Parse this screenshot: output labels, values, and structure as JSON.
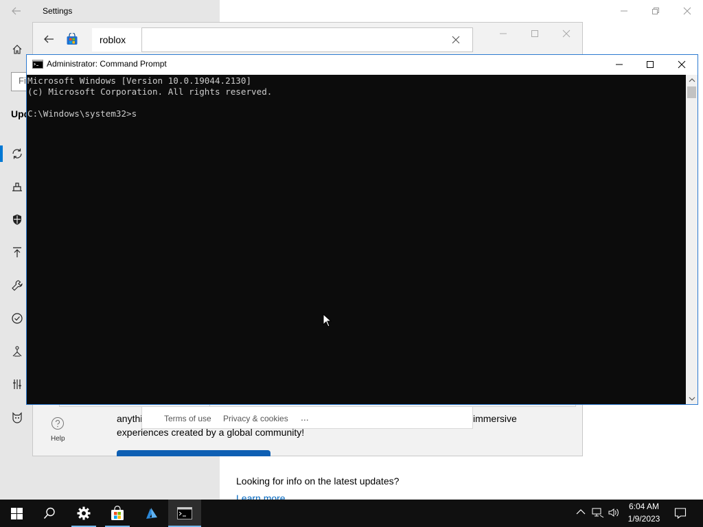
{
  "settings": {
    "title": "Settings",
    "search_placeholder": "Fi",
    "section_heading": "Upd",
    "footer_text": "Looking for info on the latest updates?",
    "footer_link": "Learn more"
  },
  "store": {
    "search_query": "roblox",
    "description_line1_left": "anythi",
    "description_line1_right": "immersive",
    "description_line2": "experiences created by a global community!",
    "footer_terms": "Terms of use",
    "footer_privacy": "Privacy & cookies",
    "footer_more": "...",
    "help_label": "Help"
  },
  "cmd": {
    "title": "Administrator: Command Prompt",
    "lines": [
      "Microsoft Windows [Version 10.0.19044.2130]",
      "(c) Microsoft Corporation. All rights reserved.",
      "",
      "C:\\Windows\\system32>s"
    ]
  },
  "taskbar": {
    "time": "6:04 AM",
    "date": "1/9/2023",
    "apps": [
      "start-icon",
      "search-icon",
      "settings-icon",
      "store-icon",
      "azure-icon",
      "cmd-icon"
    ]
  },
  "colors": {
    "accent": "#0078d4",
    "console_bg": "#0c0c0c",
    "console_text": "#cccccc",
    "taskbar_bg": "#101010"
  }
}
